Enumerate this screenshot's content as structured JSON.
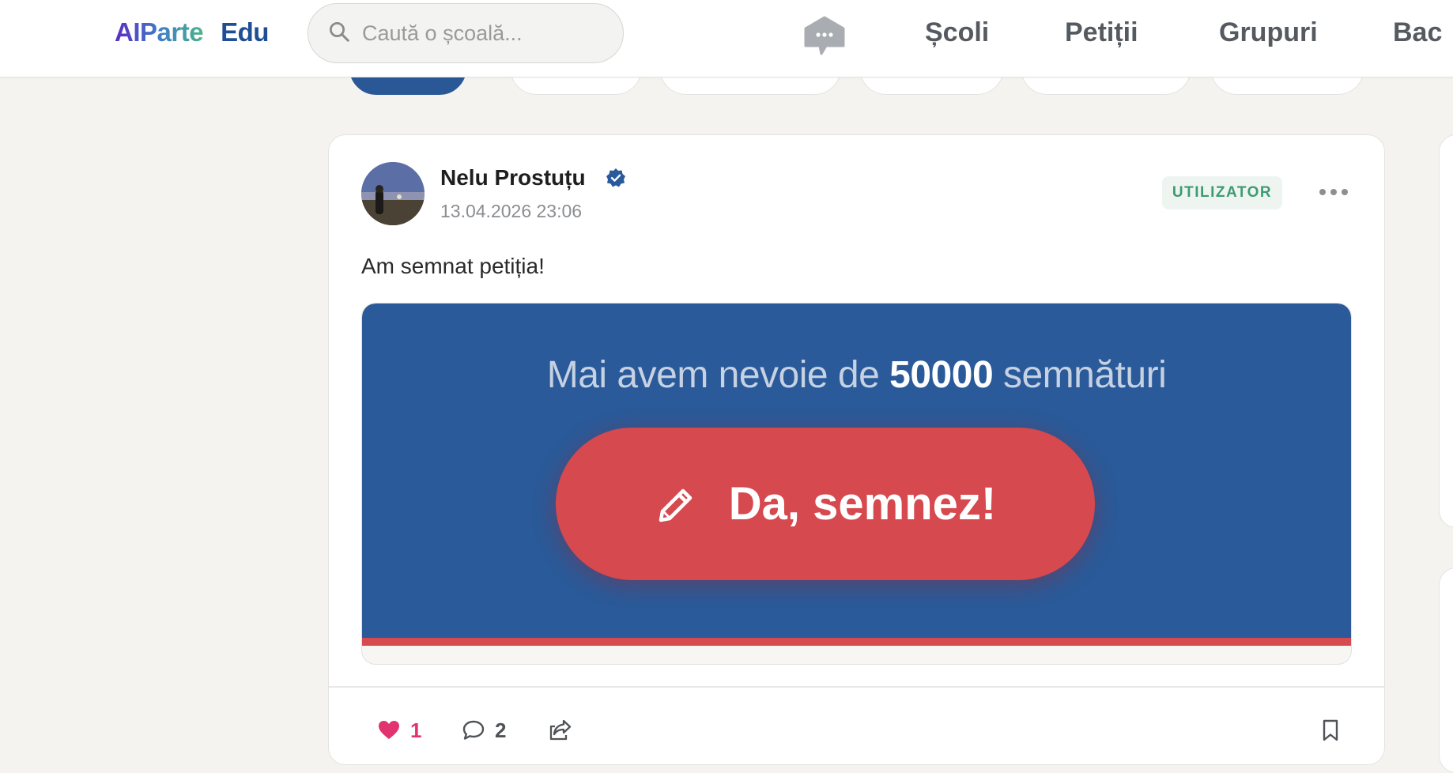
{
  "header": {
    "logo_main": "AIParte",
    "logo_sub": "Edu",
    "search_placeholder": "Caută o școală...",
    "nav": [
      "Școli",
      "Petiții",
      "Grupuri",
      "Bac"
    ]
  },
  "post": {
    "author": "Nelu Prostuțu",
    "timestamp": "13.04.2026 23:06",
    "role": "UTILIZATOR",
    "text": "Am semnat petiția!",
    "petition": {
      "heading_prefix": "Mai avem nevoie de",
      "heading_number": "50000",
      "heading_suffix": "semnături",
      "sign_label": "Da, semnez!"
    },
    "likes": "1",
    "comments": "2"
  },
  "colors": {
    "brand_blue": "#2a5a99",
    "sign_red": "#d6494e",
    "like_pink": "#e0336f",
    "badge_green": "#3d9b72"
  },
  "icons": [
    "search-icon",
    "chat-bubble-icon",
    "verified-icon",
    "more-icon",
    "pencil-icon",
    "heart-icon",
    "comment-icon",
    "share-icon",
    "bookmark-icon"
  ]
}
